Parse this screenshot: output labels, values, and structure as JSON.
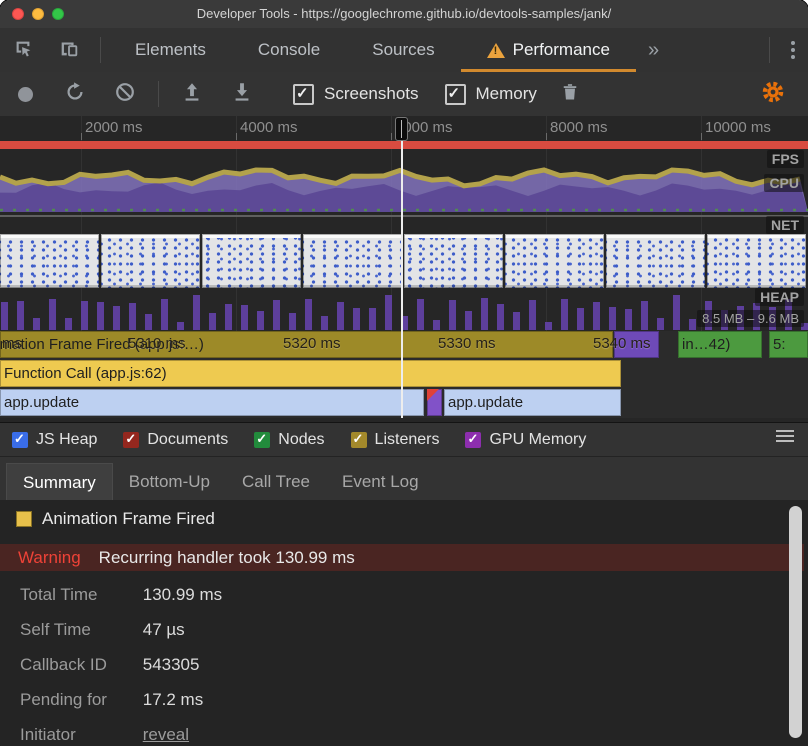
{
  "window": {
    "title": "Developer Tools - https://googlechrome.github.io/devtools-samples/jank/"
  },
  "main_tabs": {
    "items": [
      "Elements",
      "Console",
      "Sources",
      "Performance"
    ],
    "active": "Performance"
  },
  "perf_toolbar": {
    "screenshots_label": "Screenshots",
    "memory_label": "Memory"
  },
  "timeline_ruler": {
    "labels": [
      "2000 ms",
      "4000 ms",
      "6000 ms",
      "8000 ms",
      "10000 ms"
    ]
  },
  "tracks": {
    "fps_label": "FPS",
    "cpu_label": "CPU",
    "net_label": "NET",
    "heap_label": "HEAP",
    "heap_range": "8.5 MB – 9.6 MB"
  },
  "flame_chart": {
    "ruler_labels": [
      "ms",
      "5310 ms",
      "5320 ms",
      "5330 ms",
      "5340 ms"
    ],
    "rows": [
      {
        "segments": [
          {
            "label": "Animation Frame Fired (app.js:…)",
            "color": "#9d8a28"
          },
          {
            "label": "",
            "color": "#6e4ab8"
          },
          {
            "label": "in…42)",
            "color": "#4c9a3f"
          },
          {
            "label": "5:",
            "color": "#4c9a3f"
          }
        ]
      },
      {
        "segments": [
          {
            "label": "Function Call (app.js:62)",
            "color": "#eeca50"
          }
        ]
      },
      {
        "segments": [
          {
            "label": "app.update",
            "color": "#bdd0f1"
          },
          {
            "label": "",
            "color": "#8152c8"
          },
          {
            "label": "app.update",
            "color": "#bdd0f1"
          }
        ]
      }
    ]
  },
  "legend": {
    "items": [
      {
        "label": "JS Heap",
        "color": "#3a6de8"
      },
      {
        "label": "Documents",
        "color": "#94271e"
      },
      {
        "label": "Nodes",
        "color": "#228b3c"
      },
      {
        "label": "Listeners",
        "color": "#a3892b"
      },
      {
        "label": "GPU Memory",
        "color": "#8d2eae"
      }
    ]
  },
  "detail_tabs": {
    "items": [
      "Summary",
      "Bottom-Up",
      "Call Tree",
      "Event Log"
    ],
    "active": "Summary"
  },
  "summary": {
    "title": "Animation Frame Fired",
    "title_color": "#e7c04b",
    "warning_label": "Warning",
    "warning_text": "Recurring handler took 130.99 ms",
    "rows": [
      {
        "label": "Total Time",
        "value": "130.99 ms"
      },
      {
        "label": "Self Time",
        "value": "47 µs"
      },
      {
        "label": "Callback ID",
        "value": "543305"
      },
      {
        "label": "Pending for",
        "value": "17.2 ms"
      }
    ],
    "initiator_label": "Initiator",
    "initiator_link": "reveal"
  }
}
